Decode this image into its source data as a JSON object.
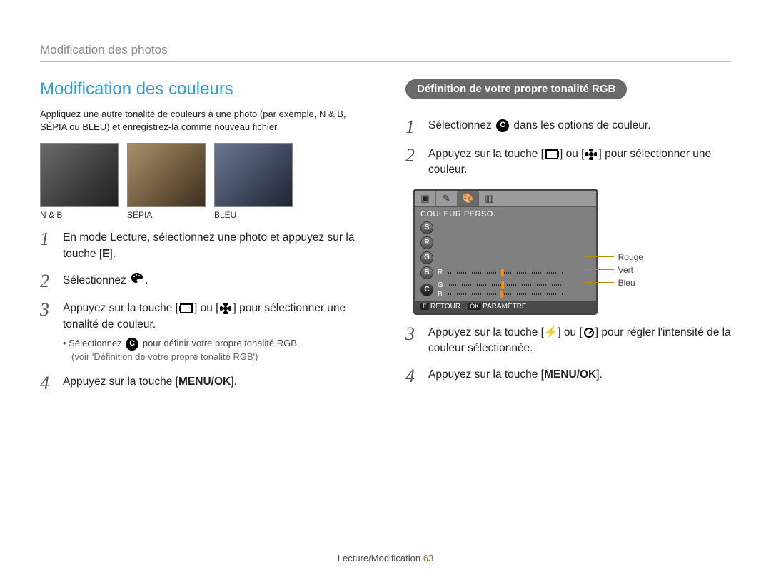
{
  "header": "Modification des photos",
  "footer": {
    "section": "Lecture/Modification",
    "page": "63"
  },
  "left": {
    "title": "Modification des couleurs",
    "intro": "Appliquez une autre tonalité de couleurs à une photo (par exemple, N & B, SÉPIA ou BLEU) et enregistrez-la comme nouveau fichier.",
    "thumbs": {
      "nb": "N & B",
      "sepia": "SÉPIA",
      "bleu": "BLEU"
    },
    "steps": {
      "s1": "En mode Lecture, sélectionnez une photo et appuyez sur la touche [",
      "s1_key": "E",
      "s1_end": "].",
      "s2": "Sélectionnez ",
      "s3a": "Appuyez sur la touche [",
      "s3b": "] ou [",
      "s3c": "] pour sélectionner une tonalité de couleur.",
      "s3_bullet_a": "Sélectionnez ",
      "s3_bullet_b": " pour définir votre propre tonalité RGB.",
      "s3_sub": "(voir 'Définition de votre propre tonalité RGB')",
      "s4a": "Appuyez sur la touche [",
      "s4_key": "MENU/OK",
      "s4b": "]."
    }
  },
  "right": {
    "pill": "Définition de votre propre tonalité RGB",
    "steps": {
      "s1a": "Sélectionnez ",
      "s1b": " dans les options de couleur.",
      "s2a": "Appuyez sur la touche [",
      "s2b": "] ou [",
      "s2c": "] pour sélectionner une couleur.",
      "s3a": "Appuyez sur la touche [",
      "s3b": "] ou [",
      "s3c": "] pour régler l'intensité de la couleur sélectionnée.",
      "s4a": "Appuyez sur la touche [",
      "s4_key": "MENU/OK",
      "s4b": "]."
    },
    "device": {
      "subtitle": "COULEUR PERSO.",
      "rgb": {
        "r": "R",
        "g": "G",
        "b": "B"
      },
      "retour": "RETOUR",
      "param": "PARAMÈTRE",
      "retour_btn": "E",
      "param_btn": "OK",
      "callouts": {
        "rouge": "Rouge",
        "vert": "Vert",
        "bleu": "Bleu"
      }
    }
  }
}
